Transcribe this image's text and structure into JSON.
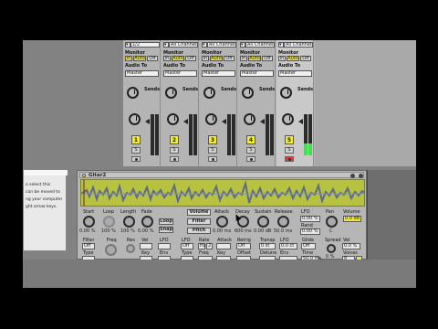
{
  "mixer": {
    "strips": [
      {
        "input": "1/2",
        "monitor": {
          "in": "In",
          "auto": "Auto",
          "off": "Off"
        },
        "audio_to_label": "Audio To",
        "monitor_label": "Monitor",
        "dest": "Master",
        "sends_label": "Sends",
        "number": "1",
        "solo": "S",
        "armed": false,
        "meter": 0.0
      },
      {
        "input": "All Channels",
        "monitor": {
          "in": "In",
          "auto": "Auto",
          "off": "Off"
        },
        "audio_to_label": "Audio To",
        "monitor_label": "Monitor",
        "dest": "Master",
        "sends_label": "Sends",
        "number": "2",
        "solo": "S",
        "armed": false,
        "meter": 0.0
      },
      {
        "input": "All Channels",
        "monitor": {
          "in": "In",
          "auto": "Auto",
          "off": "Off"
        },
        "audio_to_label": "Audio To",
        "monitor_label": "Monitor",
        "dest": "Master",
        "sends_label": "Sends",
        "number": "3",
        "solo": "S",
        "armed": false,
        "meter": 0.0
      },
      {
        "input": "All Channels",
        "monitor": {
          "in": "In",
          "auto": "Auto",
          "off": "Off"
        },
        "audio_to_label": "Audio To",
        "monitor_label": "Monitor",
        "dest": "Master",
        "sends_label": "Sends",
        "number": "4",
        "solo": "S",
        "armed": false,
        "meter": 0.0
      },
      {
        "input": "All Channels",
        "monitor": {
          "in": "In",
          "auto": "Auto",
          "off": "Off"
        },
        "audio_to_label": "Audio To",
        "monitor_label": "Monitor",
        "dest": "Master",
        "sends_label": "Sends",
        "number": "5",
        "solo": "S",
        "armed": true,
        "meter": 0.3
      }
    ]
  },
  "help": {
    "lines": [
      "o select this",
      "can be moved to",
      "ng your computer",
      "ght arrow keys."
    ]
  },
  "device": {
    "title": "Gitar2",
    "row1": {
      "start": {
        "label": "Start",
        "value": "0.00 %"
      },
      "loop": {
        "label": "Loop",
        "value": "100 %"
      },
      "length": {
        "label": "Length",
        "value": "100 %"
      },
      "fade": {
        "label": "Fade",
        "value": "0.00 %"
      },
      "loop_btn": "Loop",
      "snap_btn": "Snap",
      "volume_tab": "Volume",
      "filter_tab": "Filter",
      "pitch_tab": "Pitch",
      "attack": {
        "label": "Attack",
        "value": "0.00 ms"
      },
      "decay": {
        "label": "Decay",
        "value": "600 ms"
      },
      "sustain": {
        "label": "Sustain",
        "value": "0.00 dB"
      },
      "release": {
        "label": "Release",
        "value": "50.0 ms"
      },
      "lfo": {
        "label": "LFO",
        "value": "0.00 %"
      },
      "rand": {
        "label": "Rand",
        "value": "0.00 %"
      },
      "pan": {
        "label": "Pan",
        "value": "C"
      },
      "volume": {
        "label": "Volume",
        "value": "0.0 dB"
      }
    },
    "row2": {
      "filter": {
        "label": "Filter",
        "value": "Off"
      },
      "type": "Type",
      "freq": "Freq",
      "res": "Res",
      "vel": "Vel",
      "lfo": "LFO",
      "key": "Key",
      "env": "Env",
      "lfo2": {
        "label": "LFO",
        "value": "Off"
      },
      "rate": {
        "label": "Rate",
        "value": "2"
      },
      "hz": "Hz",
      "attack": "Attack",
      "retrig": {
        "label": "Retrig",
        "value": "Off"
      },
      "transp": {
        "label": "Transp",
        "value": "0 st"
      },
      "lfo3": {
        "label": "LFO",
        "value": "0.0 ct"
      },
      "glide": {
        "label": "Glide",
        "value": "Off"
      },
      "spread": {
        "label": "Spread",
        "value": "0 %"
      },
      "vel2": {
        "label": "Vel",
        "value": "0.0 %"
      },
      "type2": "Type",
      "freq2": "Freq",
      "key2": "Key",
      "offset": "Offset",
      "detune": "Detune",
      "env2": "Env",
      "time": {
        "label": "Time",
        "value": "50.0 ms"
      },
      "voices": {
        "label": "Voices",
        "value": "8"
      }
    }
  },
  "colors": {
    "accent": "#f1e63b",
    "waveform": "#b6c240",
    "meter": "#3fe24b",
    "arm": "#e23a3a"
  }
}
